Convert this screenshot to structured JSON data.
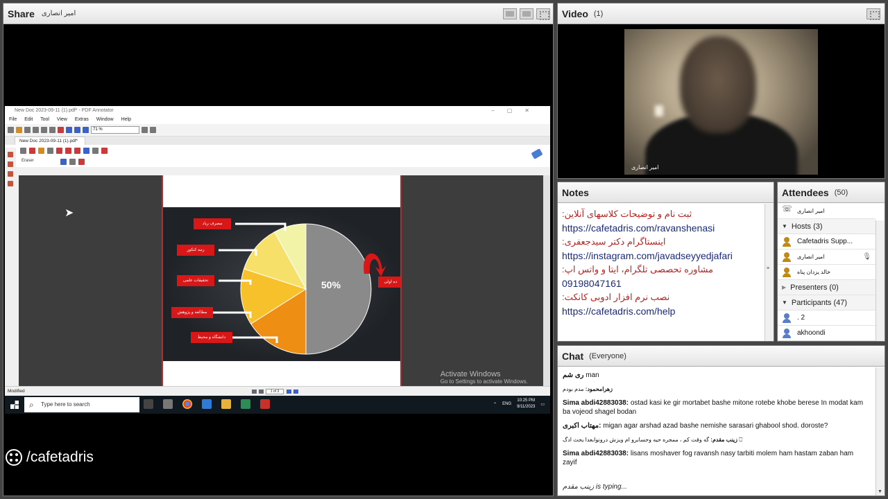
{
  "share": {
    "title": "Share",
    "presenter": "امیر انصاری",
    "app": {
      "window_title": "New Doc 2023-09-11 (1).pdf* - PDF Annotator",
      "menu": [
        "File",
        "Edit",
        "Tool",
        "View",
        "Extras",
        "Window",
        "Help"
      ],
      "zoom": "71 %",
      "tab": "New Doc 2023-09-11 (1).pdf*",
      "tool_label": "Eraser",
      "status": "Modified",
      "page_indicator": "1 of 3",
      "activate_title": "Activate Windows",
      "activate_sub": "Go to Settings to activate Windows."
    },
    "slide": {
      "center_label": "50%",
      "labels": [
        "مصرف زیاد",
        "رتبه کنکور",
        "تحقیقات علمی",
        "مطالعه و پژوهش",
        "دانشگاه و محیط"
      ],
      "right_label": "ده اولی",
      "chart_data": {
        "type": "pie",
        "values": [
          50,
          16,
          14,
          12,
          8
        ],
        "colors": [
          "#8a8a8a",
          "#ee8f13",
          "#f6c12a",
          "#f7e06a",
          "#f3f3a8"
        ]
      }
    },
    "taskbar": {
      "search_placeholder": "Type here to search",
      "lang": "ENG",
      "time": "10:25 PM",
      "date": "9/11/2023"
    },
    "logo": "/cafetadris"
  },
  "video": {
    "title": "Video",
    "count": "(1)",
    "caption": "امیر انصاری"
  },
  "notes": {
    "title": "Notes",
    "lines": [
      {
        "text": "ثبت نام و توضیحات کلاسهای آنلاین:",
        "kind": "fa"
      },
      {
        "text": "https://cafetadris.com/ravanshenasi",
        "kind": "en"
      },
      {
        "text": "اینستاگرام دکتر سیدجعفری:",
        "kind": "fa"
      },
      {
        "text": "https://instagram.com/javadseyyedjafari",
        "kind": "en"
      },
      {
        "text": "مشاوره تحصصی تلگرام، ایتا و واتس اپ:",
        "kind": "fa"
      },
      {
        "text": "09198047161",
        "kind": "en"
      },
      {
        "text": "نصب نرم افزار ادوبی کانکت:",
        "kind": "fa"
      },
      {
        "text": "https://cafetadris.com/help",
        "kind": "en"
      }
    ]
  },
  "attendees": {
    "title": "Attendees",
    "count": "(50)",
    "me": "امیر انصاری",
    "hosts_label": "Hosts (3)",
    "hosts": [
      "Cafetadris Supp...",
      "امیر انصاری",
      "خالد یزدان پناه"
    ],
    "presenters_label": "Presenters (0)",
    "participants_label": "Participants (47)",
    "participants": [
      ". 2",
      "akhoondi"
    ]
  },
  "chat": {
    "title": "Chat",
    "scope": "(Everyone)",
    "messages": [
      {
        "name": "ری شم",
        "text": "man",
        "rtl": true,
        "small": false
      },
      {
        "name": "زهرامحمود:",
        "text": "مدم بودم",
        "rtl": true,
        "small": true
      },
      {
        "name": "Sima abdi42883038:",
        "text": "ostad kasi ke gir mortabet bashe mitone rotebe khobe berese In modat kam ba vojeod shagel bodan",
        "rtl": false,
        "small": false
      },
      {
        "name": "مهتاب اکبری:",
        "text": "migan agar arshad azad bashe nemishe sarasari ghabool shod. doroste?",
        "rtl": false,
        "small": false
      },
      {
        "name": "زینب مقدم:",
        "text": "گه وقت کم ، ممجره حیه وحسابرو ام ویزش درونوابعدا یحث ادگ ⎕",
        "rtl": true,
        "small": true
      },
      {
        "name": "Sima abdi42883038:",
        "text": "lisans moshaver fog ravansh nasy tarbiti molem ham hastam zaban ham zayif",
        "rtl": false,
        "small": false
      }
    ],
    "typing": "زینب مقدم is typing..."
  }
}
